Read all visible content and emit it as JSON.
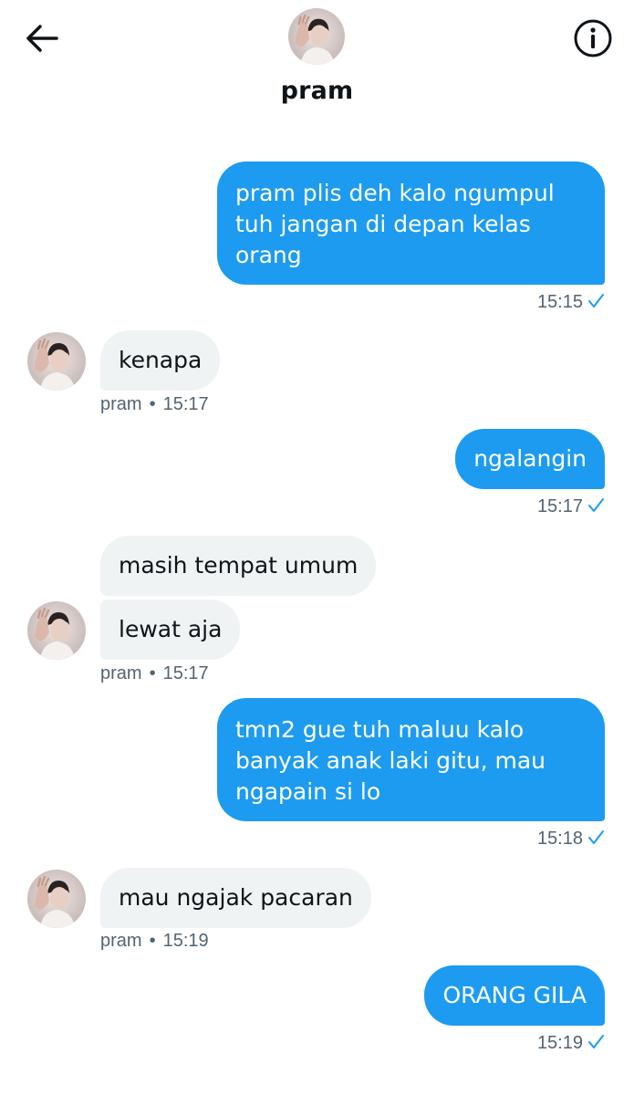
{
  "header": {
    "name": "pram"
  },
  "messages": [
    {
      "direction": "out",
      "lines": [
        "pram plis deh kalo ngumpul",
        "tuh jangan di depan kelas",
        "orang"
      ],
      "time": "15:15"
    },
    {
      "direction": "in",
      "text": "kenapa",
      "sender": "pram",
      "time": "15:17"
    },
    {
      "direction": "out",
      "text": "ngalangin",
      "time": "15:17"
    },
    {
      "direction": "in",
      "text": "masih tempat umum"
    },
    {
      "direction": "in",
      "text": "lewat aja",
      "sender": "pram",
      "time": "15:17"
    },
    {
      "direction": "out",
      "lines": [
        "tmn2 gue tuh maluu kalo",
        "banyak anak laki gitu, mau",
        "ngapain si lo"
      ],
      "time": "15:18"
    },
    {
      "direction": "in",
      "text": "mau ngajak pacaran",
      "sender": "pram",
      "time": "15:19"
    },
    {
      "direction": "out",
      "text": "ORANG GILA",
      "time": "15:19"
    }
  ],
  "colors": {
    "outgoing_bubble": "#1d9bf0",
    "incoming_bubble": "#eff3f4",
    "read_check": "#1d9bf0",
    "meta_text": "#536471"
  },
  "icons": {
    "back": "arrow-left-icon",
    "info": "info-icon",
    "read": "checkmark-icon"
  }
}
